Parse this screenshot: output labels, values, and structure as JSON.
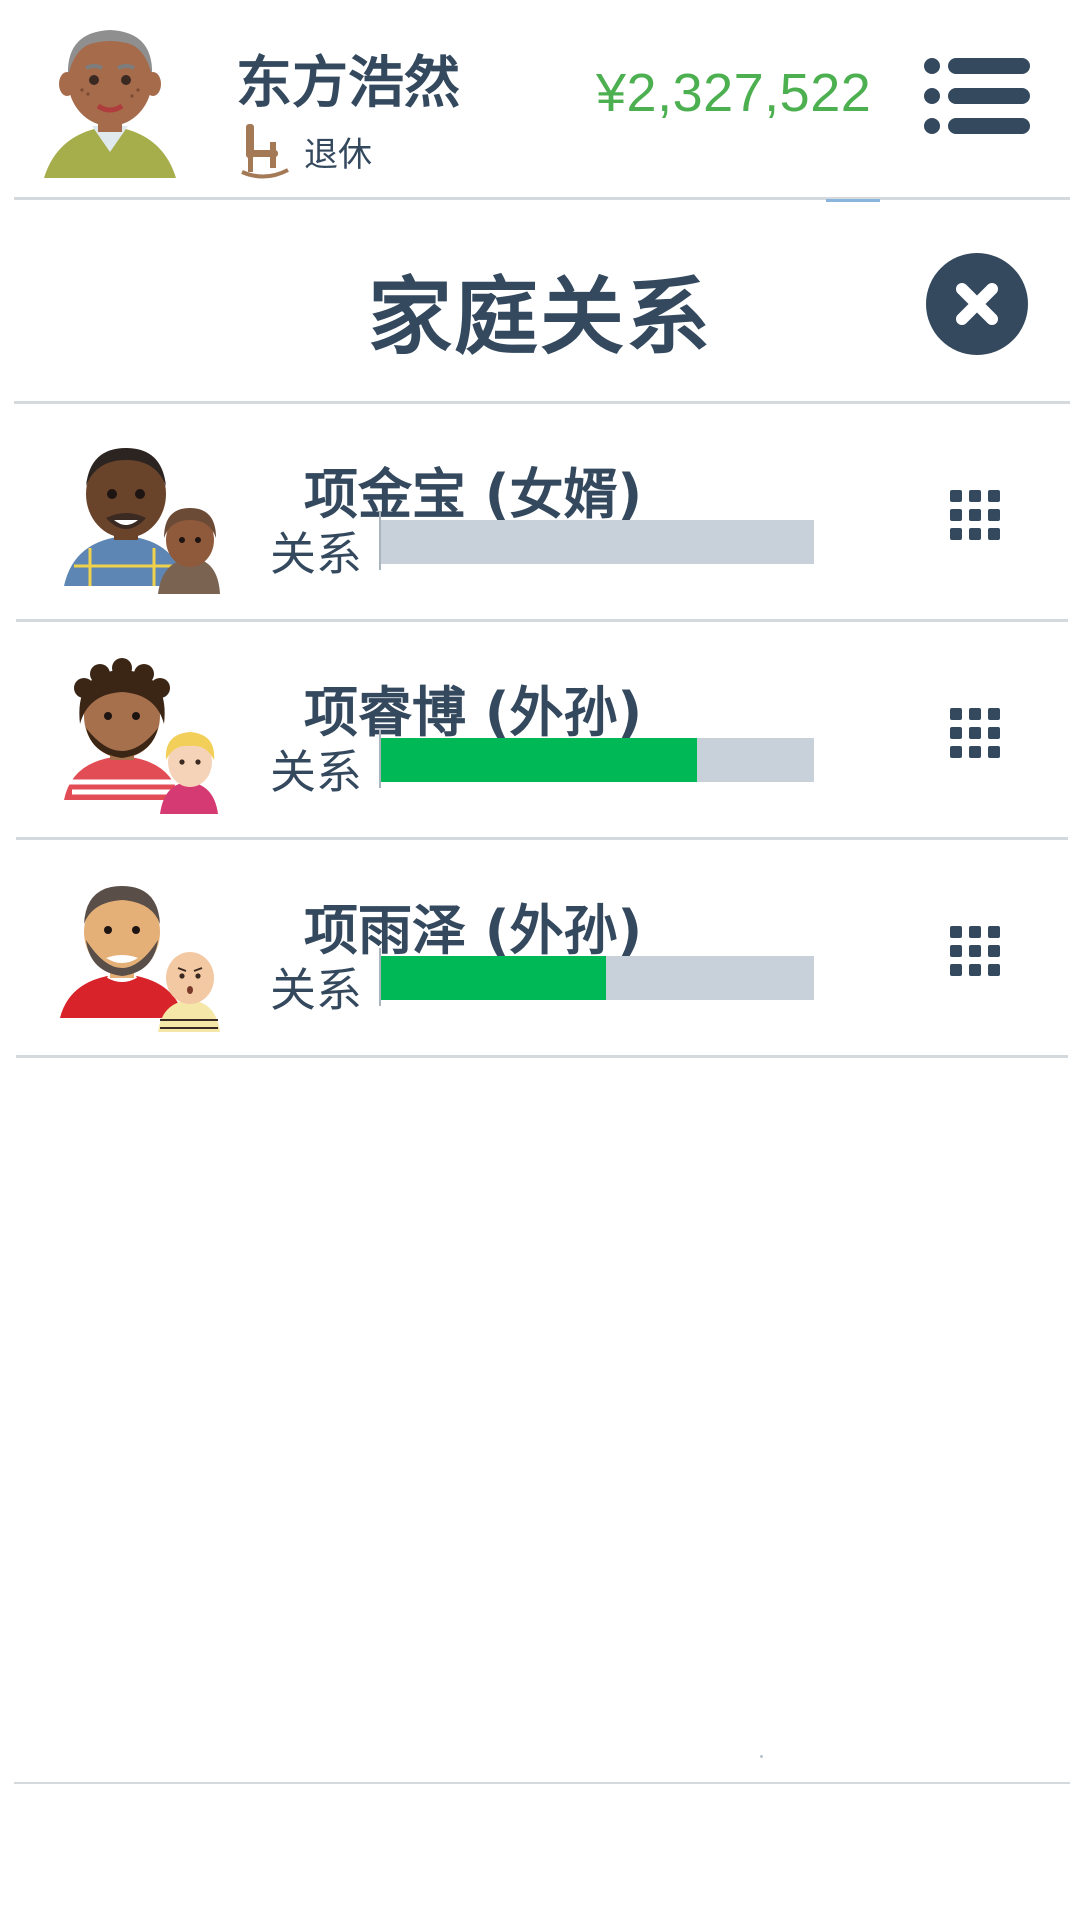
{
  "player": {
    "name": "东方浩然",
    "status": "退休",
    "money": "¥2,327,522"
  },
  "dialog": {
    "title": "家庭关系"
  },
  "relatives": [
    {
      "name": "项金宝 (女婿)",
      "rel_label": "关系",
      "relationship": 0
    },
    {
      "name": "项睿博 (外孙)",
      "rel_label": "关系",
      "relationship": 0.73
    },
    {
      "name": "项雨泽 (外孙)",
      "rel_label": "关系",
      "relationship": 0.52
    }
  ],
  "icons": {
    "menu": "menu-list-icon",
    "close": "close-icon",
    "options": "grid-dots-icon",
    "status": "rocking-chair-icon"
  },
  "colors": {
    "text": "#34495e",
    "money": "#4caf50",
    "bar_fill": "#00b956",
    "bar_track": "#c8d1d9"
  }
}
